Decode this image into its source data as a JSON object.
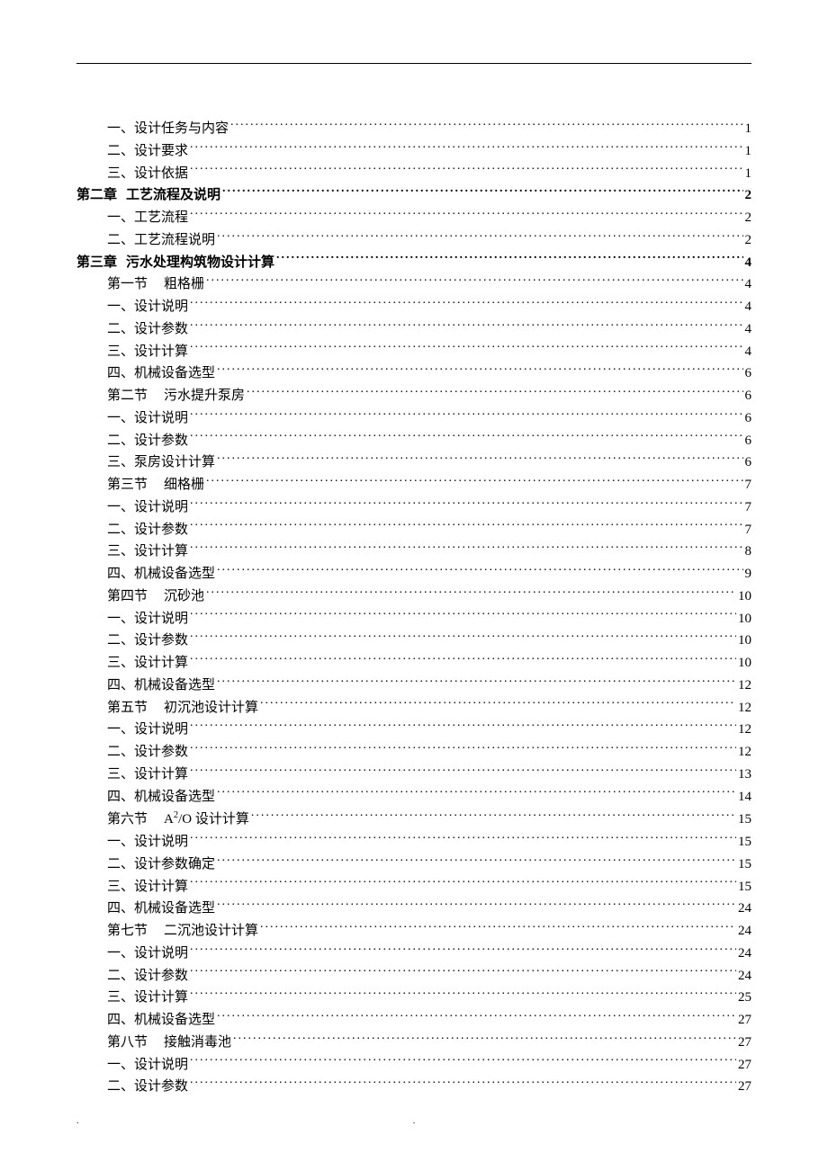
{
  "toc": [
    {
      "level": "item",
      "text": "一、设计任务与内容",
      "page": "1"
    },
    {
      "level": "item",
      "text": "二、设计要求",
      "page": "1"
    },
    {
      "level": "item",
      "text": "三、设计依据",
      "page": "1"
    },
    {
      "level": "chapter",
      "prefix": "第二章",
      "text": "工艺流程及说明",
      "page": "2"
    },
    {
      "level": "item",
      "text": "一、工艺流程",
      "page": "2"
    },
    {
      "level": "item",
      "text": "二、工艺流程说明",
      "page": "2"
    },
    {
      "level": "chapter",
      "prefix": "第三章",
      "text": "污水处理构筑物设计计算",
      "page": "4"
    },
    {
      "level": "section",
      "prefix": "第一节",
      "text": "粗格栅",
      "page": "4"
    },
    {
      "level": "item",
      "text": "一、设计说明",
      "page": "4"
    },
    {
      "level": "item",
      "text": "二、设计参数",
      "page": "4"
    },
    {
      "level": "item",
      "text": "三、设计计算",
      "page": "4"
    },
    {
      "level": "item",
      "text": "四、机械设备选型",
      "page": "6"
    },
    {
      "level": "section",
      "prefix": "第二节",
      "text": "污水提升泵房",
      "page": "6"
    },
    {
      "level": "item",
      "text": "一、设计说明",
      "page": "6"
    },
    {
      "level": "item",
      "text": "二、设计参数",
      "page": "6"
    },
    {
      "level": "item",
      "text": "三、泵房设计计算",
      "page": "6"
    },
    {
      "level": "section",
      "prefix": "第三节",
      "text": "细格栅",
      "page": "7"
    },
    {
      "level": "item",
      "text": "一、设计说明",
      "page": "7"
    },
    {
      "level": "item",
      "text": "二、设计参数",
      "page": "7"
    },
    {
      "level": "item",
      "text": "三、设计计算",
      "page": "8"
    },
    {
      "level": "item",
      "text": "四、机械设备选型",
      "page": "9"
    },
    {
      "level": "section",
      "prefix": "第四节",
      "text": "沉砂池",
      "page": "10"
    },
    {
      "level": "item",
      "text": "一、设计说明",
      "page": "10"
    },
    {
      "level": "item",
      "text": "二、设计参数",
      "page": "10"
    },
    {
      "level": "item",
      "text": "三、设计计算",
      "page": "10"
    },
    {
      "level": "item",
      "text": "四、机械设备选型",
      "page": "12"
    },
    {
      "level": "section",
      "prefix": "第五节",
      "text": "初沉池设计计算",
      "page": "12"
    },
    {
      "level": "item",
      "text": "一、设计说明",
      "page": "12"
    },
    {
      "level": "item",
      "text": "二、设计参数",
      "page": "12"
    },
    {
      "level": "item",
      "text": "三、设计计算",
      "page": "13"
    },
    {
      "level": "item",
      "text": "四、机械设备选型",
      "page": "14"
    },
    {
      "level": "section",
      "prefix": "第六节",
      "text": "A²/O 设计计算",
      "page": "15",
      "html": true
    },
    {
      "level": "item",
      "text": "一、设计说明",
      "page": "15"
    },
    {
      "level": "item",
      "text": "二、设计参数确定",
      "page": "15"
    },
    {
      "level": "item",
      "text": "三、设计计算",
      "page": "15"
    },
    {
      "level": "item",
      "text": "四、机械设备选型",
      "page": "24"
    },
    {
      "level": "section",
      "prefix": "第七节",
      "text": "二沉池设计计算",
      "page": "24"
    },
    {
      "level": "item",
      "text": "一、设计说明",
      "page": "24"
    },
    {
      "level": "item",
      "text": "二、设计参数",
      "page": "24"
    },
    {
      "level": "item",
      "text": "三、设计计算",
      "page": "25"
    },
    {
      "level": "item",
      "text": "四、机械设备选型",
      "page": "27"
    },
    {
      "level": "section",
      "prefix": "第八节",
      "text": "接触消毒池",
      "page": "27"
    },
    {
      "level": "item",
      "text": "一、设计说明",
      "page": "27"
    },
    {
      "level": "item",
      "text": "二、设计参数",
      "page": "27"
    }
  ],
  "footer_dot": ".",
  "bottom_left_dot": "."
}
